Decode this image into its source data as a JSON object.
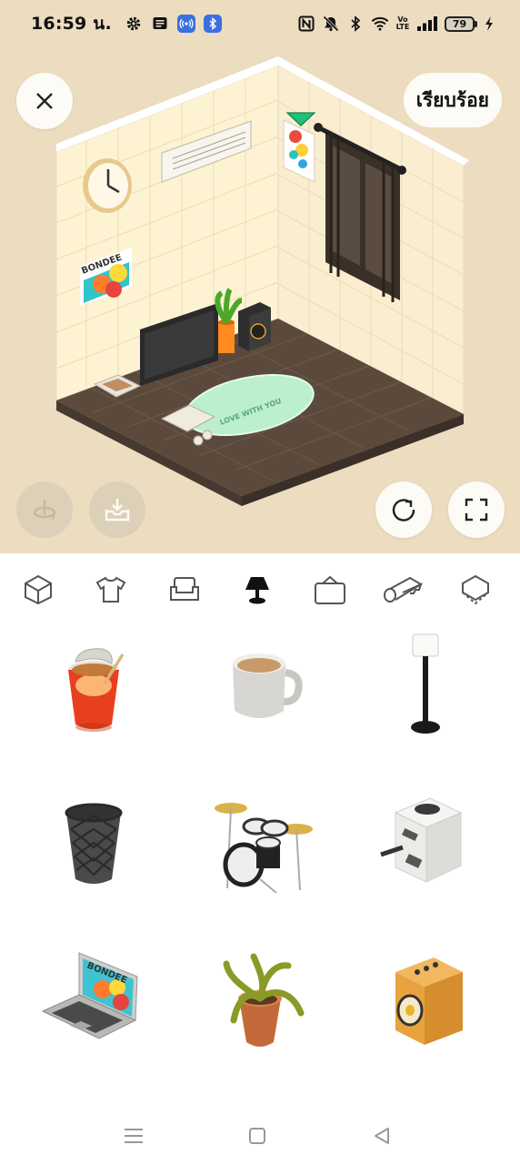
{
  "status_bar": {
    "time": "16:59 น.",
    "left_icons": [
      "gear-icon",
      "message-icon",
      "broadcast-icon",
      "bluetooth-app-icon"
    ],
    "right_icons": [
      "nfc-icon",
      "mute-icon",
      "bluetooth-icon",
      "wifi-icon",
      "volte-icon",
      "signal-icon"
    ],
    "volte_label": "Vo\nLTE",
    "battery_level": "79",
    "charging": true
  },
  "room": {
    "done_label": "เรียบร้อย",
    "poster_label": "BONDEE",
    "rug_text": "LOVE WITH YOU"
  },
  "toolbar": {
    "close_icon": "close-icon",
    "rotate_icon": "rotate-icon",
    "save_icon": "tray-download-icon",
    "reset_icon": "refresh-icon",
    "fullscreen_icon": "fullscreen-icon"
  },
  "categories": [
    {
      "icon": "cube-icon",
      "selected": false
    },
    {
      "icon": "shirt-icon",
      "selected": false
    },
    {
      "icon": "sofa-icon",
      "selected": false
    },
    {
      "icon": "lamp-icon",
      "selected": true
    },
    {
      "icon": "wall-frame-icon",
      "selected": false
    },
    {
      "icon": "floor-roll-icon",
      "selected": false
    },
    {
      "icon": "wall-icon",
      "selected": false
    }
  ],
  "items": [
    {
      "name": "cup-noodle"
    },
    {
      "name": "coffee-mug"
    },
    {
      "name": "floor-lamp"
    },
    {
      "name": "waste-basket"
    },
    {
      "name": "drum-set"
    },
    {
      "name": "espresso-machine"
    },
    {
      "name": "laptop",
      "label": "BONDEE"
    },
    {
      "name": "potted-plant"
    },
    {
      "name": "speaker"
    }
  ],
  "nav": [
    "menu-icon",
    "home-icon",
    "back-icon"
  ]
}
